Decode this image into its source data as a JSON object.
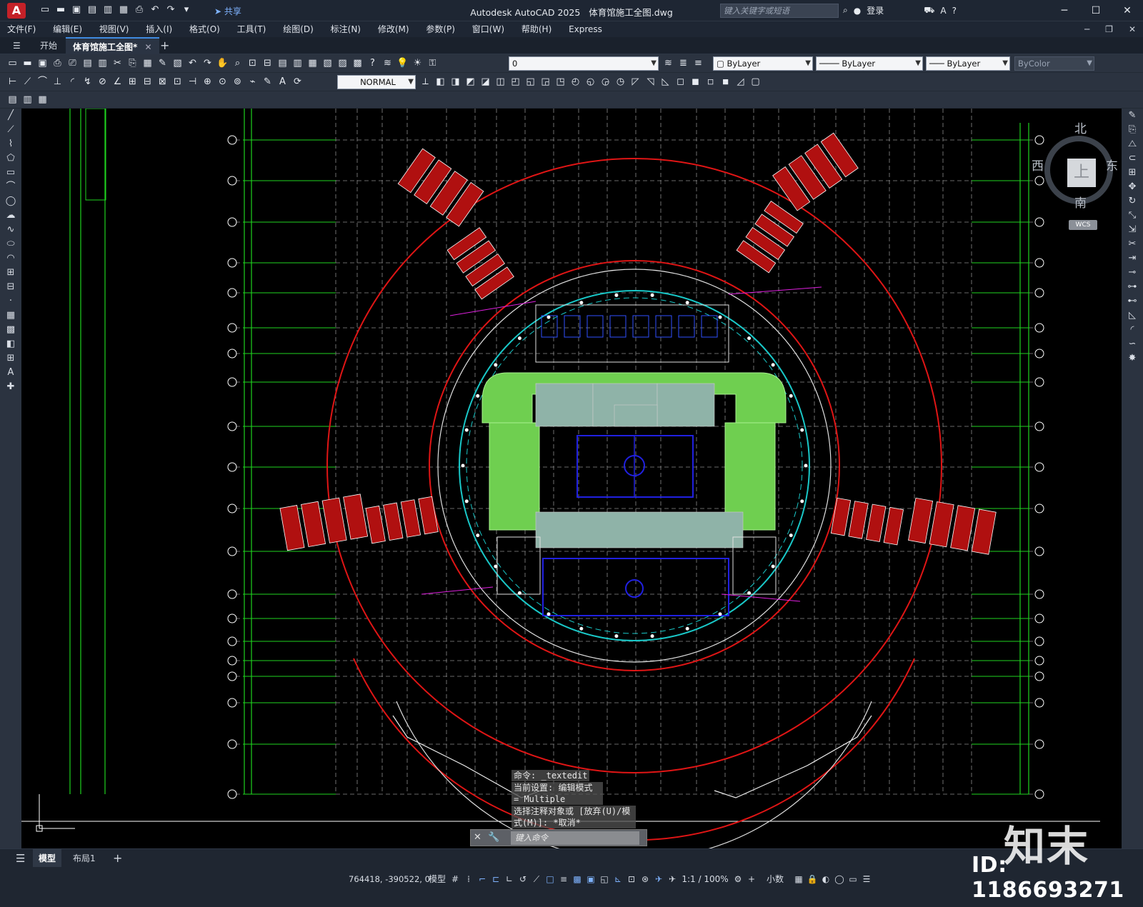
{
  "window": {
    "app_title": "Autodesk AutoCAD 2025",
    "document_title": "体育馆施工全图.dwg",
    "share_label": "共享",
    "search_placeholder": "键入关键字或短语",
    "login_label": "登录"
  },
  "menu": [
    "文件(F)",
    "编辑(E)",
    "视图(V)",
    "插入(I)",
    "格式(O)",
    "工具(T)",
    "绘图(D)",
    "标注(N)",
    "修改(M)",
    "参数(P)",
    "窗口(W)",
    "帮助(H)",
    "Express"
  ],
  "tabs": {
    "start": "开始",
    "active": "体育馆施工全图*"
  },
  "toolbar": {
    "layer_value": "0",
    "color_value": "ByLayer",
    "linetype_value": "ByLayer",
    "lineweight_value": "ByLayer",
    "plotstyle_value": "ByColor",
    "dimstyle_value": "NORMAL"
  },
  "viewcube": {
    "top": "上",
    "north": "北",
    "south": "南",
    "east": "东",
    "west": "西",
    "wcs": "WCS"
  },
  "command": {
    "history": [
      "命令: _textedit",
      "当前设置: 编辑模式 = Multiple",
      "选择注释对象或 [放弃(U)/模式(M)]: *取消*"
    ],
    "placeholder": "键入命令"
  },
  "layout_tabs": [
    "模型",
    "布局1"
  ],
  "status": {
    "coords": "764418, -390522, 0",
    "space": "模型",
    "scale": "1:1 / 100%",
    "units": "小数"
  },
  "watermark": {
    "id_text": "ID: 1186693271",
    "brand": "知末"
  }
}
